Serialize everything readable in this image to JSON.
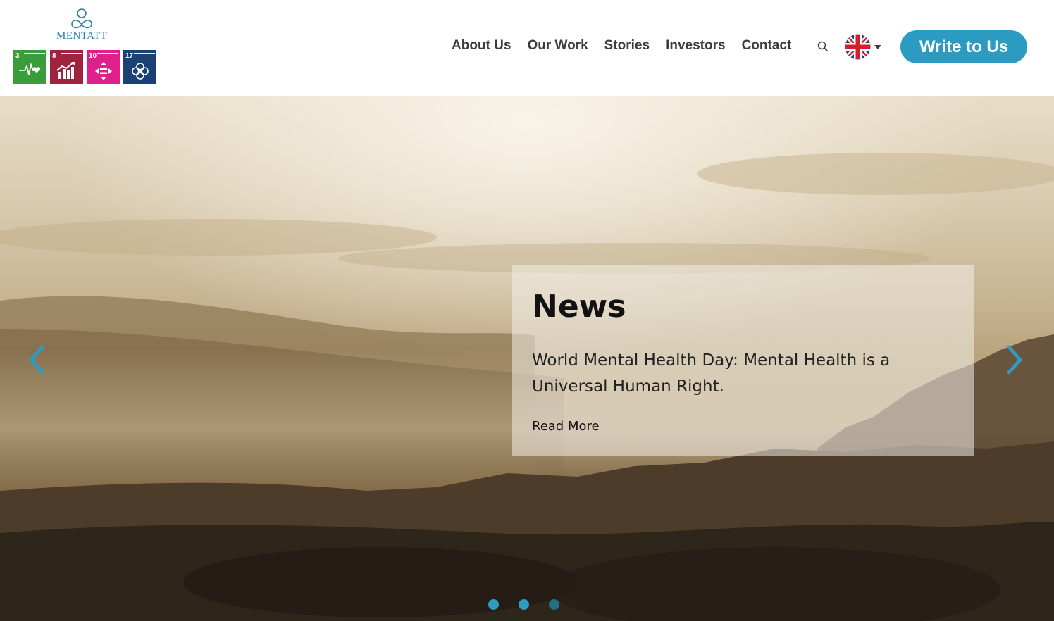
{
  "brand": {
    "name": "MENTATT",
    "accent": "#2b9bc2"
  },
  "sdg_badges": [
    {
      "number": "3",
      "color": "#3a9d3c",
      "icon": "heartbeat-icon"
    },
    {
      "number": "8",
      "color": "#a0223e",
      "icon": "growth-chart-icon"
    },
    {
      "number": "10",
      "color": "#e0208a",
      "icon": "equality-icon"
    },
    {
      "number": "17",
      "color": "#1b4074",
      "icon": "partnership-flower-icon"
    }
  ],
  "nav": {
    "items": [
      "About Us",
      "Our Work",
      "Stories",
      "Investors",
      "Contact"
    ],
    "search_icon": "search-icon",
    "language_icon": "uk-flag-icon",
    "cta_label": "Write to Us"
  },
  "hero": {
    "card": {
      "title": "News",
      "body": "World Mental Health Day: Mental Health is a Universal Human Right.",
      "link_label": "Read More"
    },
    "prev_icon": "chevron-left-icon",
    "next_icon": "chevron-right-icon",
    "slides": 3,
    "active_slide": 3
  }
}
